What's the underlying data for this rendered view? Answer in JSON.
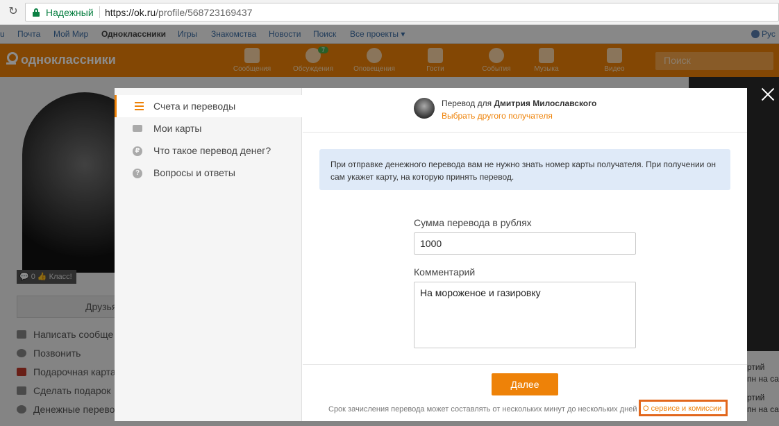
{
  "browser": {
    "secure_label": "Надежный",
    "url_host": "https://ok.ru",
    "url_path": "/profile/568723169437"
  },
  "topbar": {
    "links": [
      "u",
      "Почта",
      "Мой Мир",
      "Одноклассники",
      "Игры",
      "Знакомства",
      "Новости",
      "Поиск",
      "Все проекты ▾"
    ],
    "lang": "Рус"
  },
  "header": {
    "logo": "одноклассники",
    "nav": [
      {
        "label": "Сообщения",
        "icon": "envelope-icon"
      },
      {
        "label": "Обсуждения",
        "icon": "chat-bubbles-icon",
        "badge": "7"
      },
      {
        "label": "Оповещения",
        "icon": "bell-icon"
      },
      {
        "label": "Гости",
        "icon": "footprints-icon"
      },
      {
        "label": "События",
        "icon": "events-icon"
      },
      {
        "label": "Музыка",
        "icon": "music-note-icon"
      },
      {
        "label": "Видео",
        "icon": "video-camera-icon"
      }
    ],
    "search_placeholder": "Поиск"
  },
  "profile": {
    "stats": "💬 0  👍 Класс!",
    "friends_button": "Друзья",
    "links": [
      "Написать сообще",
      "Позвонить",
      "Подарочная карта",
      "Сделать подарок",
      "Денежные перево"
    ]
  },
  "right_col": {
    "items": [
      "ртий",
      "пн на сай",
      "ртий",
      "пн на сай"
    ]
  },
  "modal": {
    "sidebar": [
      {
        "label": "Счета и переводы",
        "active": true,
        "icon": "list-icon"
      },
      {
        "label": "Мои карты",
        "active": false,
        "icon": "card-icon"
      },
      {
        "label": "Что такое перевод денег?",
        "active": false,
        "icon": "ruble-icon"
      },
      {
        "label": "Вопросы и ответы",
        "active": false,
        "icon": "question-icon"
      }
    ],
    "recipient_prefix": "Перевод для",
    "recipient_name": "Дмитрия Милославского",
    "change_recipient": "Выбрать другого получателя",
    "info_text": "При отправке денежного перевода вам не нужно знать номер карты получателя. При получении он сам укажет карту, на которую принять перевод.",
    "amount_label": "Сумма перевода в рублях",
    "amount_value": "1000",
    "comment_label": "Комментарий",
    "comment_value": "На мороженое и газировку",
    "next_button": "Далее",
    "footer_note": "Срок зачисления перевода может составлять от нескольких минут до нескольких дней",
    "service_link": "О сервисе и комиссии"
  },
  "colors": {
    "accent": "#ee8208",
    "info_bg": "#dfeaf8",
    "highlight_box": "#e2671c",
    "secure_green": "#0b8043"
  }
}
